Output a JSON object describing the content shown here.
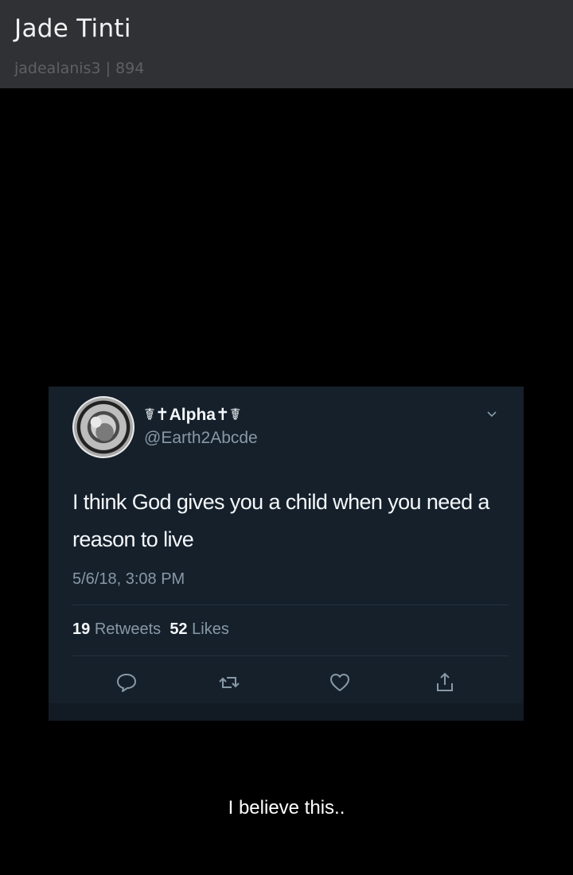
{
  "post": {
    "author_name": "Jade Tinti",
    "author_meta": "jadealanis3 | 894",
    "caption": "I believe this.."
  },
  "tweet": {
    "display_name": "☤✝Alpha✝☤",
    "handle": "@Earth2Abcde",
    "text": "I think God gives you a child when you need a reason to live",
    "timestamp": "5/6/18, 3:08 PM",
    "retweet_count": "19",
    "retweet_label": "Retweets",
    "like_count": "52",
    "like_label": "Likes"
  },
  "icons": {
    "reply": "reply-icon",
    "retweet": "retweet-icon",
    "like": "heart-icon",
    "share": "share-icon",
    "more": "chevron-down-icon"
  },
  "colors": {
    "header_bg": "#2f3134",
    "tweet_bg": "#15202b",
    "secondary_text": "#8899a6"
  }
}
